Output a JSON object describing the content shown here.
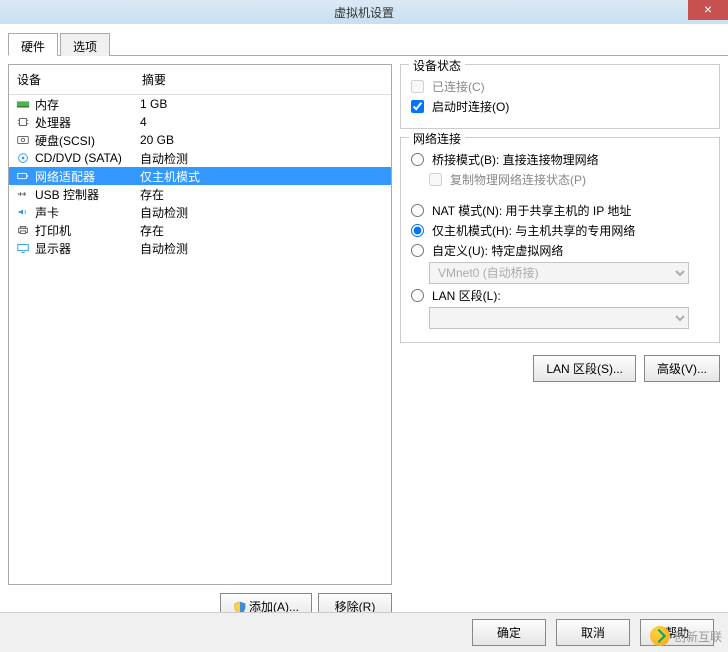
{
  "window": {
    "title": "虚拟机设置",
    "close_glyph": "×"
  },
  "tabs": {
    "hardware": "硬件",
    "options": "选项"
  },
  "device_list": {
    "header_device": "设备",
    "header_summary": "摘要",
    "rows": [
      {
        "icon": "memory-icon",
        "name": "内存",
        "summary": "1 GB"
      },
      {
        "icon": "cpu-icon",
        "name": "处理器",
        "summary": "4"
      },
      {
        "icon": "hdd-icon",
        "name": "硬盘(SCSI)",
        "summary": "20 GB"
      },
      {
        "icon": "cd-icon",
        "name": "CD/DVD (SATA)",
        "summary": "自动检测"
      },
      {
        "icon": "nic-icon",
        "name": "网络适配器",
        "summary": "仅主机模式",
        "selected": true
      },
      {
        "icon": "usb-icon",
        "name": "USB 控制器",
        "summary": "存在"
      },
      {
        "icon": "sound-icon",
        "name": "声卡",
        "summary": "自动检测"
      },
      {
        "icon": "printer-icon",
        "name": "打印机",
        "summary": "存在"
      },
      {
        "icon": "display-icon",
        "name": "显示器",
        "summary": "自动检测"
      }
    ]
  },
  "left_buttons": {
    "add": "添加(A)...",
    "remove": "移除(R)"
  },
  "device_status": {
    "title": "设备状态",
    "connected": "已连接(C)",
    "connect_at_poweron": "启动时连接(O)"
  },
  "network_connection": {
    "title": "网络连接",
    "bridged": "桥接模式(B): 直接连接物理网络",
    "replicate": "复制物理网络连接状态(P)",
    "nat": "NAT 模式(N): 用于共享主机的 IP 地址",
    "hostonly": "仅主机模式(H): 与主机共享的专用网络",
    "custom": "自定义(U): 特定虚拟网络",
    "custom_value": "VMnet0 (自动桥接)",
    "lan_segment": "LAN 区段(L):",
    "lan_value": ""
  },
  "right_buttons": {
    "lan_segments": "LAN 区段(S)...",
    "advanced": "高级(V)..."
  },
  "footer": {
    "ok": "确定",
    "cancel": "取消",
    "help": "帮助"
  },
  "watermark": "创新互联",
  "icons": {
    "memory": "#4caf50",
    "cpu": "#555",
    "hdd": "#888",
    "cd": "#2196f3",
    "nic": "#fff",
    "usb": "#555",
    "sound": "#2196f3",
    "printer": "#777",
    "display": "#2196f3"
  }
}
